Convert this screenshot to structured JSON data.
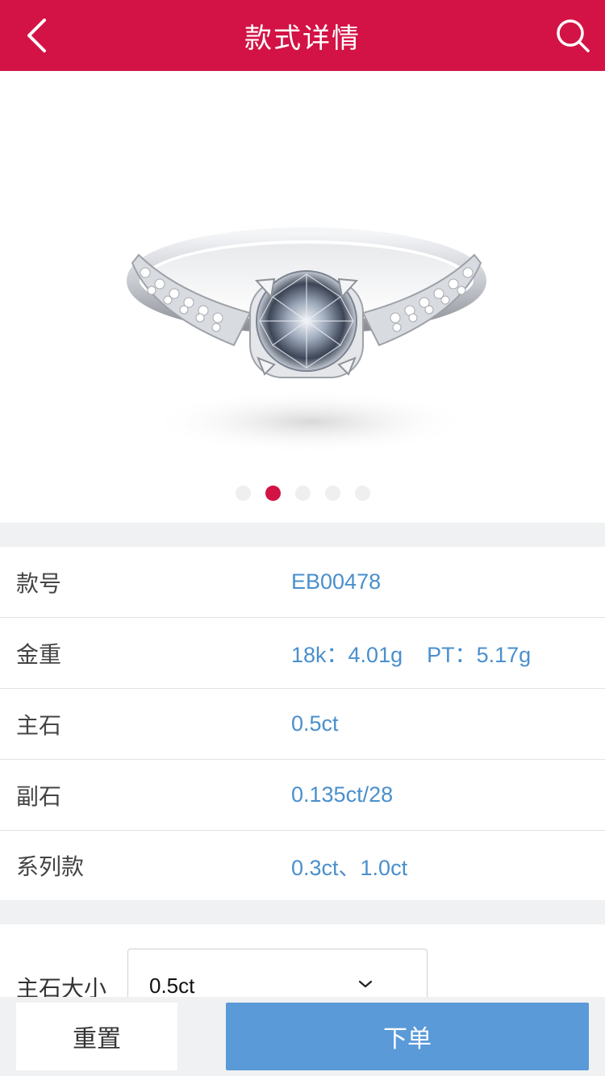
{
  "header": {
    "title": "款式详情",
    "back_icon": "chevron-left-icon",
    "search_icon": "search-icon",
    "color": "#d31345"
  },
  "gallery": {
    "image": "diamond-ring-solitaire",
    "page_count": 5,
    "active_index": 1
  },
  "specs": [
    {
      "label": "款号",
      "value": "EB00478"
    },
    {
      "label": "金重",
      "value": "18k：4.01g    PT：5.17g"
    },
    {
      "label": "主石",
      "value": "0.5ct"
    },
    {
      "label": "副石",
      "value": "0.135ct/28"
    },
    {
      "label": "系列款",
      "value": "0.3ct、1.0ct"
    }
  ],
  "options": {
    "label": "主石大小",
    "selected": "0.5ct",
    "dropdown_icon": "chevron-down-icon"
  },
  "footer": {
    "reset_label": "重置",
    "order_label": "下单",
    "order_color": "#5a9ad8"
  }
}
